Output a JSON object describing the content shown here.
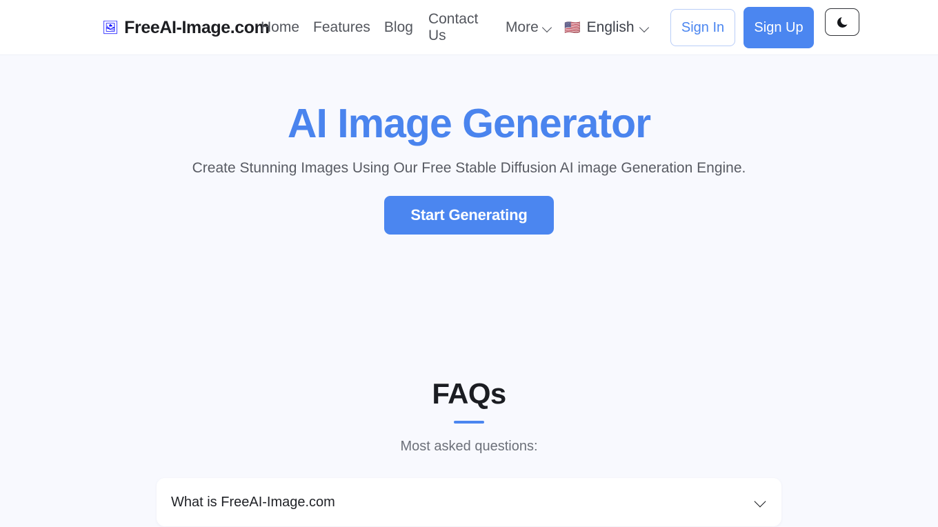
{
  "header": {
    "brand": {
      "icon": "picture-icon",
      "icon_glyph": "🖼",
      "name": "FreeAI-Image.com"
    },
    "nav": [
      {
        "label": "Home",
        "name": "nav-link-home"
      },
      {
        "label": "Features",
        "name": "nav-link-features"
      },
      {
        "label": "Blog",
        "name": "nav-link-blog"
      },
      {
        "label": "Contact Us",
        "name": "nav-link-contact-us"
      }
    ],
    "more": {
      "label": "More",
      "icon": "chevron-down-icon"
    },
    "language": {
      "flag_glyph": "🇺🇸",
      "label": "English",
      "icon": "chevron-down-icon"
    },
    "sign_in": "Sign In",
    "sign_up": "Sign Up",
    "theme_toggle": {
      "icon": "moon-icon",
      "mode": "dark"
    }
  },
  "hero": {
    "title": "AI Image Generator",
    "subtitle": "Create Stunning Images Using Our Free Stable Diffusion AI image Generation Engine.",
    "cta_label": "Start Generating"
  },
  "faq": {
    "title": "FAQs",
    "subtitle": "Most asked questions:",
    "items": [
      {
        "question": "What is FreeAI-Image.com",
        "expanded": false,
        "icon": "chevron-down-icon"
      }
    ]
  },
  "colors": {
    "accent_blue": "#4b86f0",
    "page_background": "#f8f9fe",
    "header_background": "#ffffff",
    "heading_dark": "#1b1d22",
    "body_text": "#585b63"
  }
}
